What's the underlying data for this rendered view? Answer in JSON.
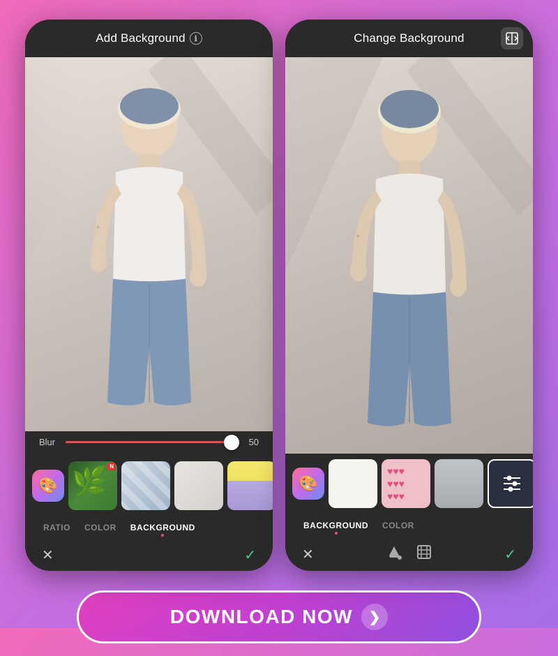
{
  "background": {
    "gradient_start": "#f06aba",
    "gradient_end": "#a66de8"
  },
  "left_phone": {
    "title": "Add Background",
    "info_icon": "ℹ",
    "blur_label": "Blur",
    "blur_value": "50",
    "tabs": [
      {
        "label": "RATIO",
        "active": false,
        "dot": false
      },
      {
        "label": "COLOR",
        "active": false,
        "dot": false
      },
      {
        "label": "BACKGROUND",
        "active": true,
        "dot": true
      }
    ],
    "cancel_icon": "✕",
    "confirm_icon": "✓",
    "thumbnails": [
      {
        "type": "app-icon",
        "emoji": "🎨"
      },
      {
        "type": "tropical",
        "has_new": true
      },
      {
        "type": "geometric"
      },
      {
        "type": "marble"
      },
      {
        "type": "pastel"
      },
      {
        "type": "floral"
      }
    ]
  },
  "right_phone": {
    "title": "Change Background",
    "compare_icon": "⊡",
    "tabs": [
      {
        "label": "BACKGROUND",
        "active": true,
        "dot": true
      },
      {
        "label": "COLOR",
        "active": false,
        "dot": false
      }
    ],
    "cancel_icon": "✕",
    "fill_icon": "◆",
    "crop_icon": "⊞",
    "confirm_icon": "✓",
    "thumbnails": [
      {
        "type": "app-icon",
        "emoji": "🎨"
      },
      {
        "type": "white"
      },
      {
        "type": "pink-hearts"
      },
      {
        "type": "gray-room"
      },
      {
        "type": "sliders",
        "selected": true
      },
      {
        "type": "galaxy"
      }
    ]
  },
  "download_button": {
    "text": "DOWNLOAD NOW",
    "arrow": "❯"
  }
}
